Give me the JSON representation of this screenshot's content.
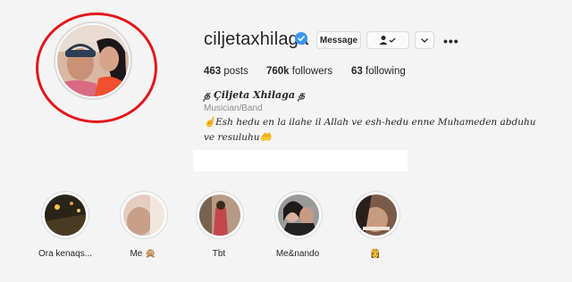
{
  "profile": {
    "username": "ciljetaxhilaga",
    "verified_icon": "verified-badge-icon",
    "message_label": "Message",
    "follow_icon": "person-check-icon",
    "chevron_icon": "chevron-down-icon",
    "more_label": "•••"
  },
  "stats": {
    "posts_count": "463",
    "posts_label": "posts",
    "followers_count": "760k",
    "followers_label": "followers",
    "following_count": "63",
    "following_label": "following"
  },
  "bio": {
    "full_name": "த Çiljeta Xhilaga த",
    "category": "Musician/Band",
    "line1": "☝️Esh hedu en la ilahe il Allah ve esh-hedu enne Muhameden abduhu",
    "line2": "ve resuluhu🤲"
  },
  "highlights": [
    {
      "label": "Ora kenaqs..."
    },
    {
      "label": "Me 🙊"
    },
    {
      "label": "Tbt"
    },
    {
      "label": "Me&nando"
    },
    {
      "label": "👸"
    }
  ],
  "colors": {
    "annotation": "#e3171d",
    "verified": "#3897f0"
  }
}
